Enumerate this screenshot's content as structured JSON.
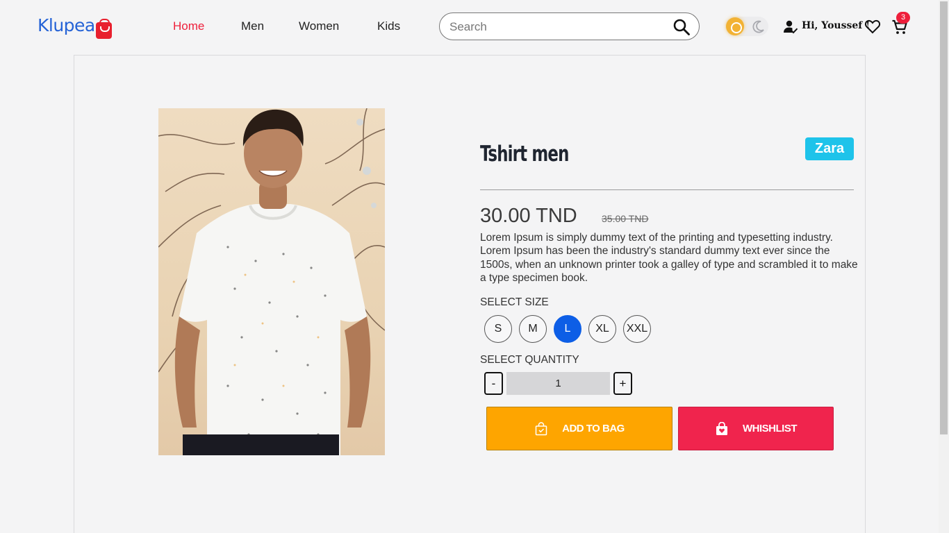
{
  "header": {
    "logo": "Klupea",
    "nav": [
      {
        "label": "Home",
        "active": true
      },
      {
        "label": "Men",
        "active": false
      },
      {
        "label": "Women",
        "active": false
      },
      {
        "label": "Kids",
        "active": false
      }
    ],
    "search_placeholder": "Search",
    "greeting": "Hi, Youssef !",
    "cart_count": "3",
    "theme": "light"
  },
  "product": {
    "title": "Tshirt men",
    "brand": "Zara",
    "price": "30.00 TND",
    "old_price": "35.00 TND",
    "description": "Lorem Ipsum is simply dummy text of the printing and typesetting industry. Lorem Ipsum has been the industry's standard dummy text ever since the 1500s, when an unknown printer took a galley of type and scrambled it to make a type specimen book.",
    "size_label": "SELECT SIZE",
    "sizes": [
      "S",
      "M",
      "L",
      "XL",
      "XXL"
    ],
    "selected_size": "L",
    "quantity_label": "SELECT QUANTITY",
    "quantity": "1",
    "minus": "-",
    "plus": "+",
    "add_to_bag": "ADD TO BAG",
    "wishlist": "WHISHLIST"
  },
  "colors": {
    "accent_red": "#ee1f3b",
    "logo_blue": "#2563d6",
    "brand_badge": "#1ec3ea",
    "selected_size": "#0d5ee6",
    "add_to_bag": "#fea500",
    "wishlist": "#f0244d"
  }
}
